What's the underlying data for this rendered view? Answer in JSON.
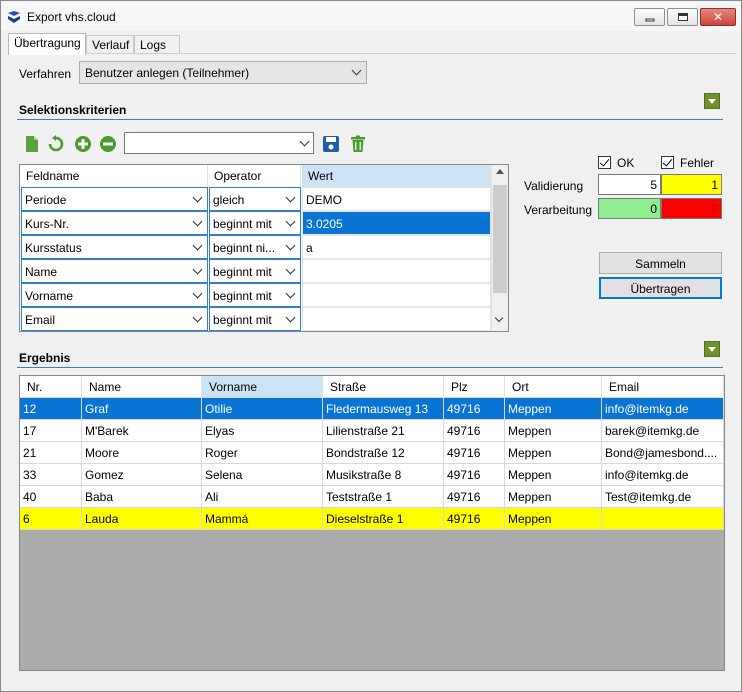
{
  "window": {
    "title": "Export vhs.cloud"
  },
  "tabs": [
    "Übertragung",
    "Verlauf",
    "Logs"
  ],
  "verfahren": {
    "label": "Verfahren",
    "value": "Benutzer anlegen (Teilnehmer)"
  },
  "selektion": {
    "title": "Selektionskriterien",
    "preset_value": "",
    "columns": [
      "Feldname",
      "Operator",
      "Wert"
    ],
    "rows": [
      {
        "field": "Periode",
        "operator": "gleich",
        "value": "DEMO"
      },
      {
        "field": "Kurs-Nr.",
        "operator": "beginnt mit",
        "value": "3.0205"
      },
      {
        "field": "Kursstatus",
        "operator": "beginnt ni...",
        "value": "a"
      },
      {
        "field": "Name",
        "operator": "beginnt mit",
        "value": ""
      },
      {
        "field": "Vorname",
        "operator": "beginnt mit",
        "value": ""
      },
      {
        "field": "Email",
        "operator": "beginnt mit",
        "value": ""
      }
    ]
  },
  "status": {
    "ok_label": "OK",
    "fehler_label": "Fehler",
    "validierung": {
      "label": "Validierung",
      "ok": "5",
      "fehler": "1"
    },
    "verarbeitung": {
      "label": "Verarbeitung",
      "ok": "0",
      "fehler": "0"
    },
    "colors": {
      "ok_green": "#90ee90",
      "fehler_yellow": "#ffff00",
      "fehler_red": "#ff0000"
    }
  },
  "buttons": {
    "sammeln": "Sammeln",
    "uebertragen": "Übertragen"
  },
  "ergebnis": {
    "title": "Ergebnis",
    "columns": [
      "Nr.",
      "Name",
      "Vorname",
      "Straße",
      "Plz",
      "Ort",
      "Email"
    ],
    "rows": [
      [
        "12",
        "Graf",
        "Otilie",
        "Fledermausweg 13",
        "49716",
        "Meppen",
        "info@itemkg.de"
      ],
      [
        "17",
        "M'Barek",
        "Elyas",
        "Lilienstraße 21",
        "49716",
        "Meppen",
        "barek@itemkg.de"
      ],
      [
        "21",
        "Moore",
        "Roger",
        "Bondstraße 12",
        "49716",
        "Meppen",
        "Bond@jamesbond...."
      ],
      [
        "33",
        "Gomez",
        "Selena",
        "Musikstraße 8",
        "49716",
        "Meppen",
        "info@itemkg.de"
      ],
      [
        "40",
        "Baba",
        "Ali",
        "Teststraße 1",
        "49716",
        "Meppen",
        "Test@itemkg.de"
      ],
      [
        "6",
        "Lauda",
        "Mammá",
        "Dieselstraße 1",
        "49716",
        "Meppen",
        ""
      ]
    ],
    "row_states": [
      "selected",
      "normal",
      "normal",
      "normal",
      "normal",
      "highlight-yellow"
    ]
  },
  "icons": [
    "app-icon",
    "new-document-icon",
    "refresh-icon",
    "add-icon",
    "remove-icon",
    "save-icon",
    "delete-icon",
    "collapse-icon"
  ]
}
